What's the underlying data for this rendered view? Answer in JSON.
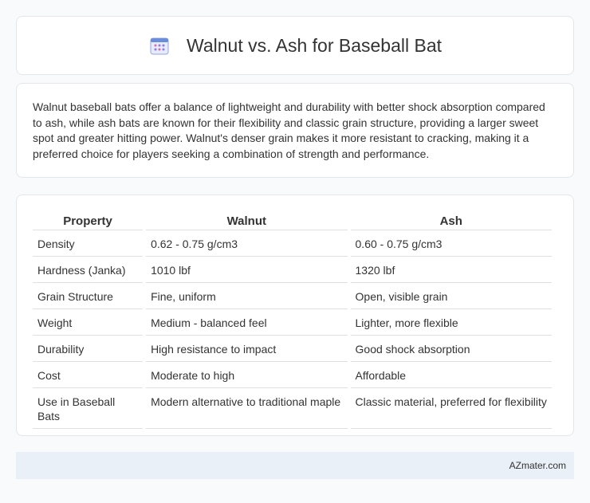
{
  "header": {
    "icon": "calendar-icon",
    "title": "Walnut vs. Ash for Baseball Bat"
  },
  "description": "Walnut baseball bats offer a balance of lightweight and durability with better shock absorption compared to ash, while ash bats are known for their flexibility and classic grain structure, providing a larger sweet spot and greater hitting power. Walnut's denser grain makes it more resistant to cracking, making it a preferred choice for players seeking a combination of strength and performance.",
  "table": {
    "headers": [
      "Property",
      "Walnut",
      "Ash"
    ],
    "rows": [
      [
        "Density",
        "0.62 - 0.75 g/cm3",
        "0.60 - 0.75 g/cm3"
      ],
      [
        "Hardness (Janka)",
        "1010 lbf",
        "1320 lbf"
      ],
      [
        "Grain Structure",
        "Fine, uniform",
        "Open, visible grain"
      ],
      [
        "Weight",
        "Medium - balanced feel",
        "Lighter, more flexible"
      ],
      [
        "Durability",
        "High resistance to impact",
        "Good shock absorption"
      ],
      [
        "Cost",
        "Moderate to high",
        "Affordable"
      ],
      [
        "Use in Baseball Bats",
        "Modern alternative to traditional maple",
        "Classic material, preferred for flexibility"
      ]
    ]
  },
  "footer": {
    "brand": "AZmater.com"
  },
  "colors": {
    "background": "#f9fafb",
    "card": "#ffffff",
    "footer": "#eaf0f8",
    "icon_accent": "#6b8cd8"
  }
}
